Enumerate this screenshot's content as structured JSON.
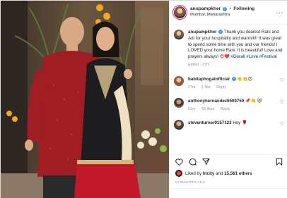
{
  "post": {
    "username": "anupampkher",
    "location": "Mumbai, Maharashtra",
    "follow_label": "Following",
    "caption": "Thank you dearest Rani and Adi for your hospitality and warmth!! It was great to spend some time with you and our friends! I LOVED your home Rani. It is beautiful! Love and prayers always! 😍❤️",
    "hashtags": "#Diwali #Love #Festival",
    "caption_time": "Edited · 27m"
  },
  "comments": [
    {
      "username": "babitaphogatofficial",
      "text": "👏👏😍",
      "time": "27m",
      "likes": "1 like",
      "reply": "Reply"
    },
    {
      "username": "anthonyhernandez6509759",
      "text": "📌👏 😻",
      "time": "51m",
      "likes": "58 likes",
      "reply": "Reply"
    },
    {
      "username": "steventurner0157123",
      "text": "Hey 🌹",
      "time": "",
      "likes": "",
      "reply": ""
    }
  ],
  "likes": {
    "prefix": "Liked by ",
    "user": "htcity",
    "middle": " and ",
    "count": "15,561 others"
  },
  "time_ago": "51 MINUTES AGO",
  "icons": {
    "like": "heart-icon",
    "comment": "comment-icon",
    "share": "share-icon",
    "save": "bookmark-icon",
    "options": "more-options-icon",
    "verified": "verified-badge-icon"
  },
  "colors": {
    "verified": "#3897f0",
    "hashtag": "#00376b",
    "muted": "#8e8e8e",
    "kurta": "#a01d24"
  }
}
